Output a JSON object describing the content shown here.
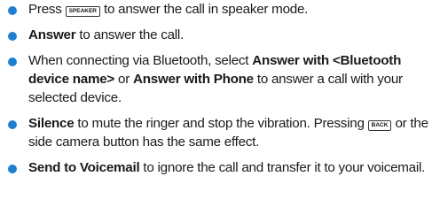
{
  "items": [
    {
      "lead": "Press",
      "key": "SPEAKER",
      "rest": "to answer the call in speaker mode."
    },
    {
      "bold": "Answer",
      "rest": "to answer the call."
    },
    {
      "text1": "When connecting via Bluetooth, select",
      "bold1": "Answer with <Bluetooth device name>",
      "or": "or",
      "bold2": "Answer with Phone",
      "text2": "to answer a call with your selected device."
    },
    {
      "bold": "Silence",
      "rest": "to mute the ringer and stop the vibration. Pressing",
      "key": "BACK",
      "rest2": "or the side camera button has the same effect."
    },
    {
      "bold": "Send to Voicemail",
      "rest": "to ignore the call and transfer it to your voicemail."
    }
  ],
  "colors": {
    "bullet": "#1e7fd0",
    "text": "#1a1a1a"
  }
}
